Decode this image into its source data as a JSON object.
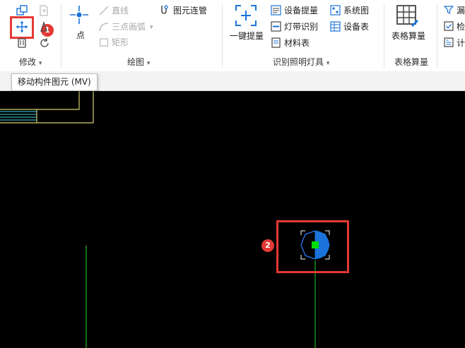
{
  "ribbon": {
    "modify": {
      "group_label": "修改"
    },
    "draw": {
      "group_label": "绘图",
      "point_label": "点",
      "line_label": "直线",
      "arc_label": "三点画弧",
      "rect_label": "矩形",
      "connect_label": "图元连管"
    },
    "identify": {
      "group_label": "识别照明灯具",
      "one_key_label": "一键提量",
      "equip_qty_label": "设备提量",
      "strip_label": "灯带识别",
      "material_label": "材料表",
      "system_label": "系统图",
      "equip_table_label": "设备表"
    },
    "table_calc": {
      "group_label": "表格算量",
      "button_label": "表格算量"
    },
    "right_partial": {
      "item1": "漏",
      "item2": "检",
      "item3": "计"
    }
  },
  "tooltip": {
    "text": "移动构件图元 (MV)"
  },
  "annotations": {
    "badge1": "1",
    "badge2": "2"
  },
  "colors": {
    "highlight": "#e53935",
    "accent_blue": "#1a73d9",
    "cad_yellow": "#d6d06a",
    "cad_cyan": "#3fd0e0",
    "cad_green": "#1aa51a",
    "selected_point": "#00e000"
  }
}
